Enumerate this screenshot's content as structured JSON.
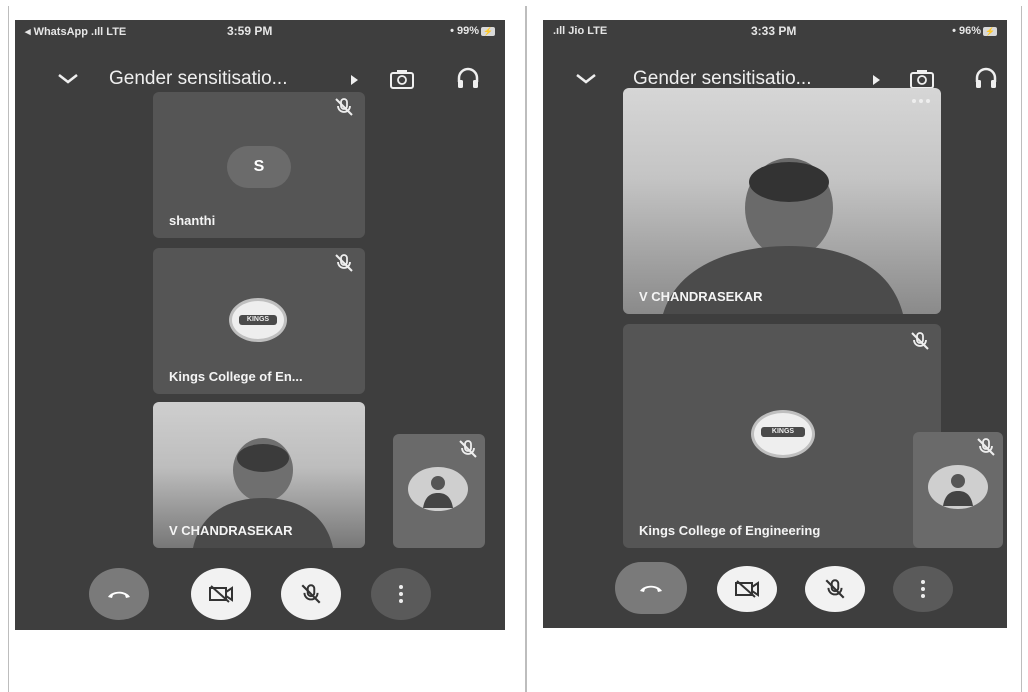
{
  "left_phone": {
    "status": {
      "carrier": "◂ WhatsApp .ıll LTE",
      "time": "3:59 PM",
      "battery": "• 99%",
      "battery_tag": "⚡"
    },
    "meeting_title": "Gender sensitisatio...",
    "tiles": [
      {
        "name": "shanthi",
        "initial": "S"
      },
      {
        "name": "Kings College of En...",
        "logo_text": "KINGS"
      },
      {
        "name": "V CHANDRASEKAR"
      }
    ]
  },
  "right_phone": {
    "status": {
      "carrier": ".ıll Jio LTE",
      "time": "3:33 PM",
      "battery": "• 96%",
      "battery_tag": "⚡"
    },
    "meeting_title": "Gender sensitisatio...",
    "tiles": [
      {
        "name": "V CHANDRASEKAR"
      },
      {
        "name": "Kings College of Engineering",
        "logo_text": "KINGS"
      }
    ]
  },
  "colors": {
    "background": "#3e3e3e",
    "tile": "#555555",
    "end_call": "#7a7a7a"
  },
  "icons": [
    "chevron-down-icon",
    "camera-switch-icon",
    "headphones-icon",
    "mic-off-icon",
    "phone-hangup-icon",
    "camera-off-icon",
    "more-vertical-icon"
  ]
}
